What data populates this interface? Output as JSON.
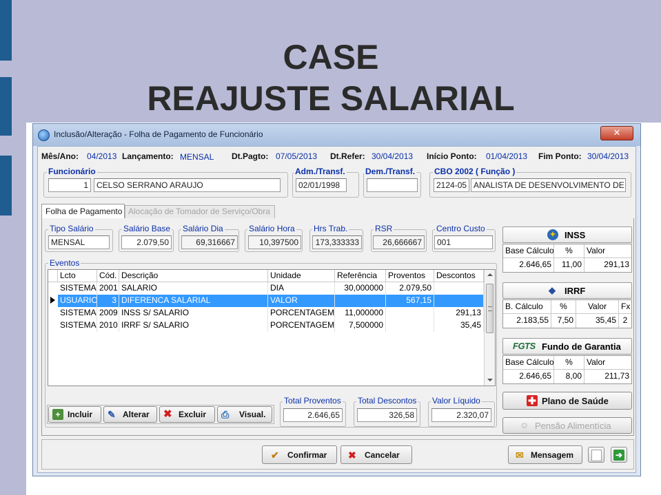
{
  "slide": {
    "title_line1": "CASE",
    "title_line2": "REAJUSTE SALARIAL",
    "accent": "#1f5c8f",
    "band": "#b8bad6"
  },
  "window": {
    "title": "Inclusão/Alteração - Folha de Pagamento de Funcionário",
    "close_icon": "close-icon"
  },
  "header": {
    "mes_ano_label": "Mês/Ano:",
    "mes_ano_value": "04/2013",
    "lancamento_label": "Lançamento:",
    "lancamento_value": "MENSAL",
    "dt_pagto_label": "Dt.Pagto:",
    "dt_pagto_value": "07/05/2013",
    "dt_refer_label": "Dt.Refer:",
    "dt_refer_value": "30/04/2013",
    "inicio_label": "Início Ponto:",
    "inicio_value": "01/04/2013",
    "fim_label": "Fim Ponto:",
    "fim_value": "30/04/2013"
  },
  "funcionario": {
    "title": "Funcionário",
    "codigo": "1",
    "nome": "CELSO SERRANO ARAUJO"
  },
  "adm": {
    "title": "Adm./Transf.",
    "value": "02/01/1998"
  },
  "dem": {
    "title": "Dem./Transf.",
    "value": ""
  },
  "cbo": {
    "title": "CBO 2002 ( Função )",
    "codigo": "2124-05",
    "descricao": "ANALISTA DE DESENVOLVIMENTO DE"
  },
  "tabs": [
    {
      "label": "Folha de Pagamento",
      "active": true
    },
    {
      "label": "Alocação de Tomador de Serviço/Obra",
      "active": false
    }
  ],
  "salary": {
    "tipo_label": "Tipo Salário",
    "tipo_value": "MENSAL",
    "base_label": "Salário Base",
    "base_value": "2.079,50",
    "dia_label": "Salário Dia",
    "dia_value": "69,316667",
    "hora_label": "Salário Hora",
    "hora_value": "10,397500",
    "hrs_label": "Hrs Trab.",
    "hrs_value": "173,333333",
    "rsr_label": "RSR",
    "rsr_value": "26,666667",
    "cc_label": "Centro Custo",
    "cc_value": "001"
  },
  "eventos": {
    "title": "Eventos",
    "columns": [
      "Lcto",
      "Cód.",
      "Descrição",
      "Unidade",
      "Referência",
      "Proventos",
      "Descontos"
    ],
    "rows": [
      {
        "lcto": "SISTEMA",
        "cod": "2001",
        "descricao": "SALARIO",
        "unidade": "DIA",
        "referencia": "30,000000",
        "proventos": "2.079,50",
        "descontos": ""
      },
      {
        "lcto": "USUARIO",
        "cod": "3",
        "descricao": "DIFERENCA SALARIAL",
        "unidade": "VALOR",
        "referencia": "",
        "proventos": "567,15",
        "descontos": ""
      },
      {
        "lcto": "SISTEMA",
        "cod": "2009",
        "descricao": "INSS S/ SALARIO",
        "unidade": "PORCENTAGEM",
        "referencia": "11,000000",
        "proventos": "",
        "descontos": "291,13"
      },
      {
        "lcto": "SISTEMA",
        "cod": "2010",
        "descricao": "IRRF S/ SALARIO",
        "unidade": "PORCENTAGEM",
        "referencia": "7,500000",
        "proventos": "",
        "descontos": "35,45"
      }
    ]
  },
  "actions": {
    "incluir": "Incluir",
    "alterar": "Alterar",
    "excluir": "Excluir",
    "visual": "Visual."
  },
  "totals": {
    "proventos_label": "Total Proventos",
    "proventos_value": "2.646,65",
    "descontos_label": "Total Descontos",
    "descontos_value": "326,58",
    "liquido_label": "Valor Líquido",
    "liquido_value": "2.320,07"
  },
  "inss": {
    "title": "INSS",
    "columns": [
      "Base Cálculo",
      "%",
      "Valor"
    ],
    "values": [
      "2.646,65",
      "11,00",
      "291,13"
    ]
  },
  "irrf": {
    "title": "IRRF",
    "columns": [
      "B. Cálculo",
      "%",
      "Valor",
      "Fx"
    ],
    "values": [
      "2.183,55",
      "7,50",
      "35,45",
      "2"
    ]
  },
  "fgts": {
    "logo": "FGTS",
    "title": "Fundo de Garantia",
    "columns": [
      "Base Cálculo",
      "%",
      "Valor"
    ],
    "values": [
      "2.646,65",
      "8,00",
      "211,73"
    ]
  },
  "side_buttons": {
    "plano_saude": "Plano de Saúde",
    "pensao": "Pensão Alimentícia"
  },
  "footer": {
    "confirmar": "Confirmar",
    "cancelar": "Cancelar",
    "mensagem": "Mensagem"
  }
}
